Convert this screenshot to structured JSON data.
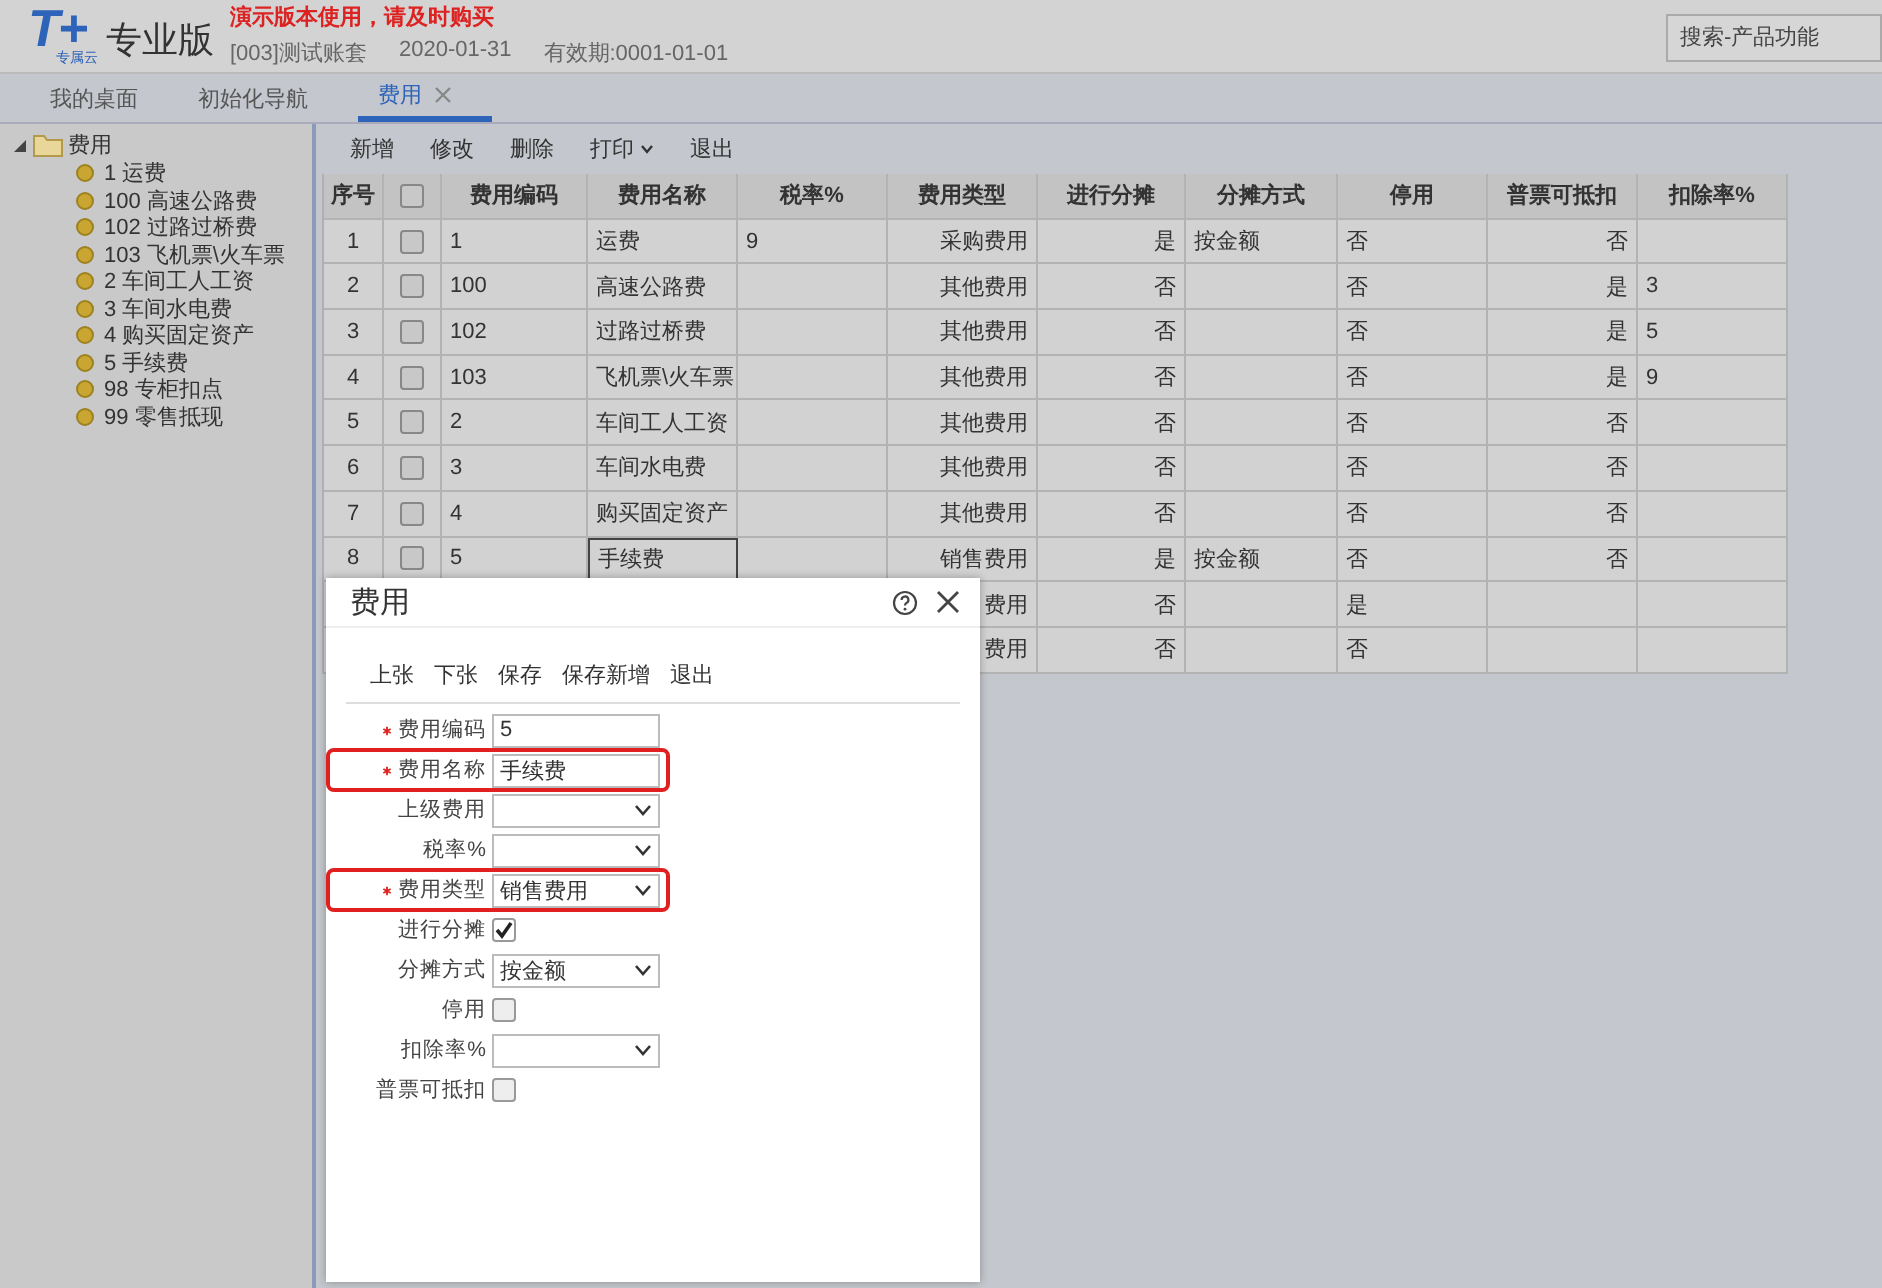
{
  "header": {
    "logo_mark": "T+",
    "logo_sub": "专属云",
    "edition": "专业版",
    "notice": "演示版本使用，请及时购买",
    "account": "[003]测试账套",
    "date": "2020-01-31",
    "validity": "有效期:0001-01-01",
    "search": {
      "placeholder": "搜索-产品功能"
    }
  },
  "tabs": [
    {
      "label": "我的桌面",
      "selected": false,
      "closable": false
    },
    {
      "label": "初始化导航",
      "selected": false,
      "closable": false
    },
    {
      "label": "费用",
      "selected": true,
      "closable": true
    }
  ],
  "tree": {
    "label": "费用",
    "expanded": true,
    "children": [
      {
        "label": "1 运费"
      },
      {
        "label": "100 高速公路费"
      },
      {
        "label": "102 过路过桥费"
      },
      {
        "label": "103 飞机票\\火车票"
      },
      {
        "label": "2 车间工人工资"
      },
      {
        "label": "3 车间水电费"
      },
      {
        "label": "4 购买固定资产"
      },
      {
        "label": "5 手续费"
      },
      {
        "label": "98 专柜扣点"
      },
      {
        "label": "99 零售抵现"
      }
    ]
  },
  "toolbar": [
    {
      "label": "新增",
      "dropdown": false
    },
    {
      "label": "修改",
      "dropdown": false
    },
    {
      "label": "删除",
      "dropdown": false
    },
    {
      "label": "打印",
      "dropdown": true
    },
    {
      "label": "退出",
      "dropdown": false
    }
  ],
  "table": {
    "header_checked": false,
    "columns": [
      "序号",
      "费用编码",
      "费用名称",
      "税率%",
      "费用类型",
      "进行分摊",
      "分摊方式",
      "停用",
      "普票可抵扣",
      "扣除率%"
    ],
    "rows": [
      {
        "checked": false,
        "selected": false,
        "cells": [
          "1",
          "1",
          "运费",
          "9",
          "采购费用",
          "是",
          "按金额",
          "否",
          "否",
          null
        ]
      },
      {
        "checked": false,
        "selected": false,
        "cells": [
          "2",
          "100",
          "高速公路费",
          null,
          "其他费用",
          "否",
          null,
          "否",
          "是",
          "3"
        ]
      },
      {
        "checked": false,
        "selected": false,
        "cells": [
          "3",
          "102",
          "过路过桥费",
          null,
          "其他费用",
          "否",
          null,
          "否",
          "是",
          "5"
        ]
      },
      {
        "checked": false,
        "selected": false,
        "cells": [
          "4",
          "103",
          "飞机票\\火车票",
          null,
          "其他费用",
          "否",
          null,
          "否",
          "是",
          "9"
        ]
      },
      {
        "checked": false,
        "selected": false,
        "cells": [
          "5",
          "2",
          "车间工人工资",
          null,
          "其他费用",
          "否",
          null,
          "否",
          "否",
          null
        ]
      },
      {
        "checked": false,
        "selected": false,
        "cells": [
          "6",
          "3",
          "车间水电费",
          null,
          "其他费用",
          "否",
          null,
          "否",
          "否",
          null
        ]
      },
      {
        "checked": false,
        "selected": false,
        "cells": [
          "7",
          "4",
          "购买固定资产",
          null,
          "其他费用",
          "否",
          null,
          "否",
          "否",
          null
        ]
      },
      {
        "checked": false,
        "selected": true,
        "cells": [
          "8",
          "5",
          "手续费",
          null,
          "销售费用",
          "是",
          "按金额",
          "否",
          "否",
          null
        ]
      },
      {
        "cells": [
          null,
          null,
          null,
          null,
          "费用",
          "否",
          null,
          "是",
          null,
          null
        ]
      },
      {
        "cells": [
          null,
          null,
          null,
          null,
          "费用",
          "否",
          null,
          "否",
          null,
          null
        ]
      }
    ]
  },
  "dialog": {
    "title": "费用",
    "actions": [
      "上张",
      "下张",
      "保存",
      "保存新增",
      "退出"
    ],
    "fields": [
      {
        "label": "费用编码",
        "kind": "text",
        "required": true,
        "highlighted": false,
        "value": "5"
      },
      {
        "label": "费用名称",
        "kind": "text",
        "required": true,
        "highlighted": true,
        "value": "手续费"
      },
      {
        "label": "上级费用",
        "kind": "select",
        "required": false,
        "highlighted": false
      },
      {
        "label": "税率%",
        "kind": "select",
        "required": false,
        "highlighted": false
      },
      {
        "label": "费用类型",
        "kind": "select",
        "required": true,
        "highlighted": true,
        "value": "销售费用"
      },
      {
        "label": "进行分摊",
        "kind": "checkbox",
        "required": false,
        "highlighted": false,
        "checked": true
      },
      {
        "label": "分摊方式",
        "kind": "select",
        "required": false,
        "highlighted": false,
        "value": "按金额"
      },
      {
        "label": "停用",
        "kind": "checkbox",
        "required": false,
        "highlighted": false,
        "checked": false
      },
      {
        "label": "扣除率%",
        "kind": "select",
        "required": false,
        "highlighted": false
      },
      {
        "label": "普票可抵扣",
        "kind": "checkbox",
        "required": false,
        "highlighted": false,
        "checked": false
      }
    ]
  }
}
